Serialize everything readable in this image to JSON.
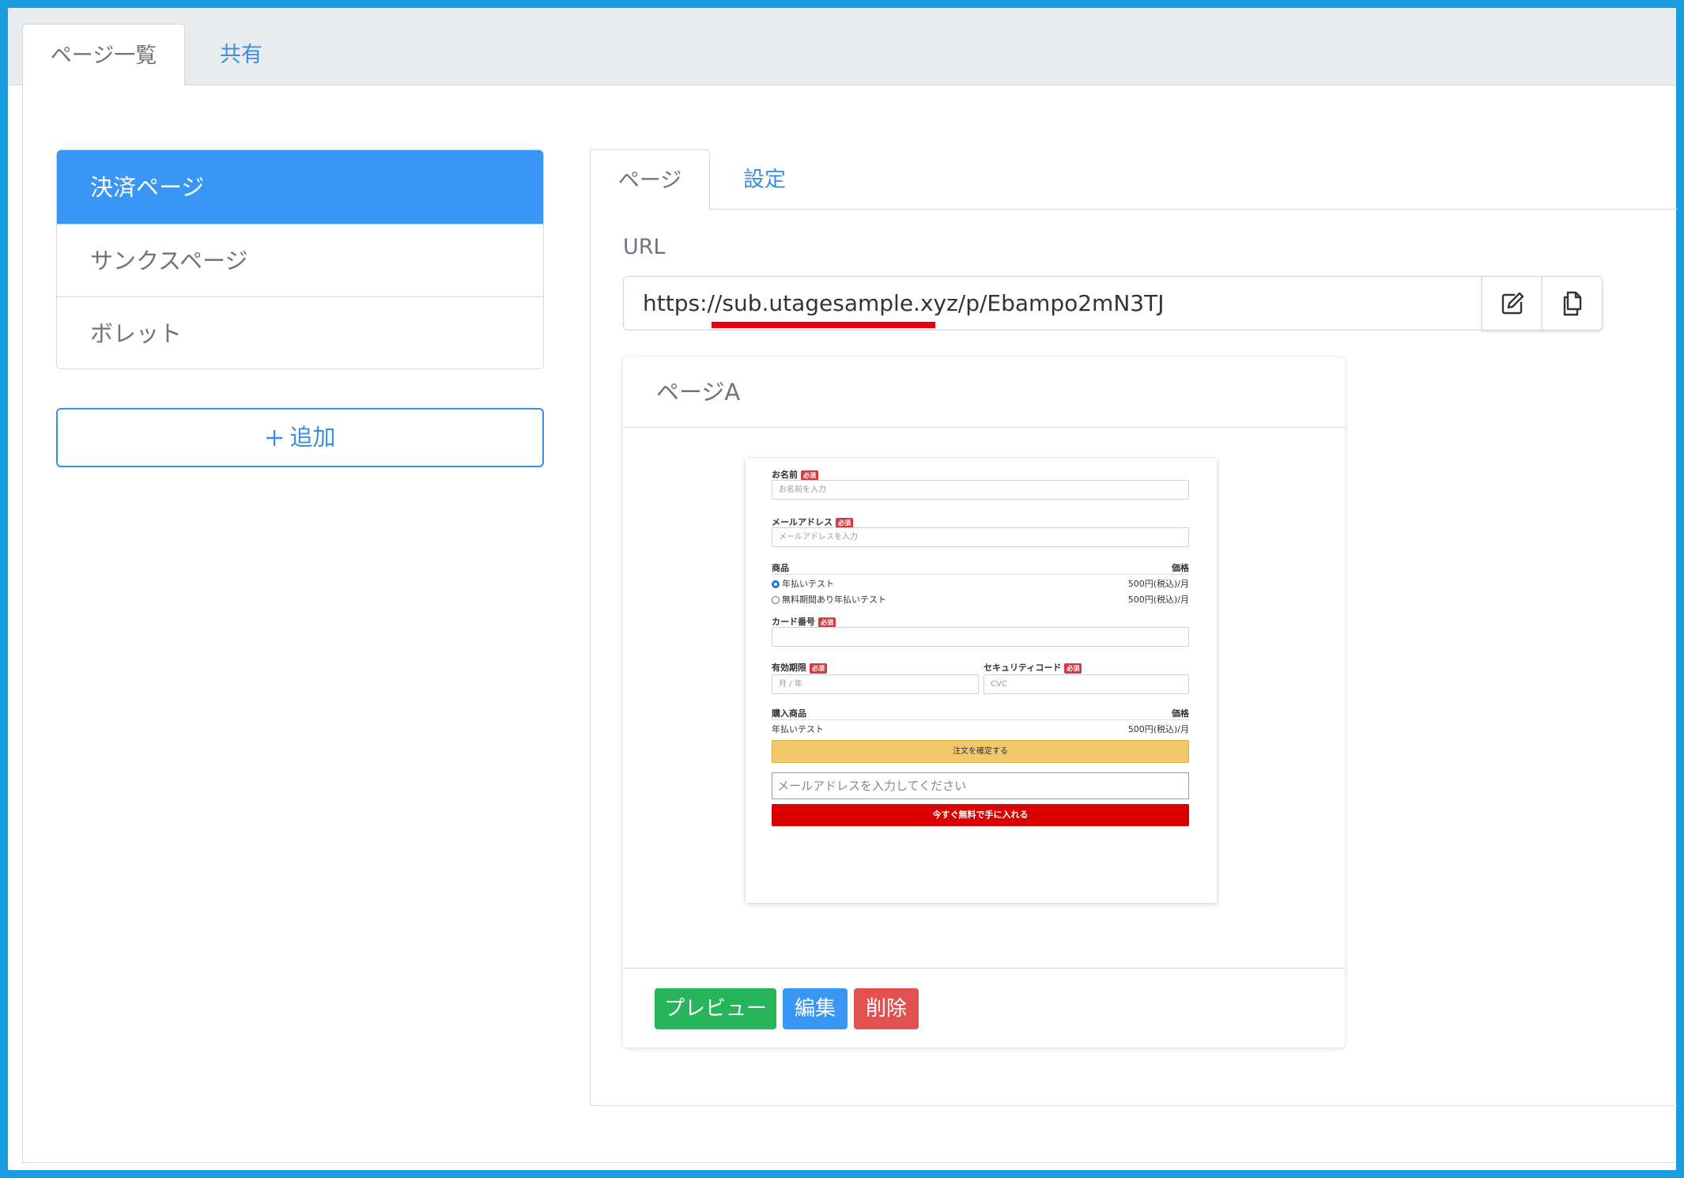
{
  "top_tabs": [
    "ページ一覧",
    "共有"
  ],
  "sidebar": {
    "items": [
      {
        "label": "決済ページ",
        "active": true
      },
      {
        "label": "サンクスページ",
        "active": false
      },
      {
        "label": "ボレット",
        "active": false
      }
    ],
    "add_label": "追加",
    "add_icon": "plus-icon"
  },
  "inner_tabs": [
    "ページ",
    "設定"
  ],
  "url": {
    "label": "URL",
    "value": "https://sub.utagesample.xyz/p/Ebampo2mN3TJ",
    "highlight_color": "#e60012",
    "edit_icon": "edit-icon",
    "copy_icon": "copy-icon"
  },
  "card": {
    "title": "ページA",
    "buttons": {
      "preview": "プレビュー",
      "edit": "編集",
      "delete": "削除"
    }
  },
  "thumbnail": {
    "required_badge": "必須",
    "name_label": "お名前",
    "name_placeholder": "お名前を入力",
    "email_label": "メールアドレス",
    "email_placeholder": "メールアドレスを入力",
    "product_header": "商品",
    "price_header": "価格",
    "products": [
      {
        "name": "年払いテスト",
        "price": "500円(税込)/月",
        "selected": true
      },
      {
        "name": "無料期間あり年払いテスト",
        "price": "500円(税込)/月",
        "selected": false
      }
    ],
    "card_label": "カード番号",
    "expiry_label": "有効期限",
    "expiry_placeholder": "月 / 年",
    "cvc_label": "セキュリティコード",
    "cvc_placeholder": "CVC",
    "purchased_header": "購入商品",
    "purchased_price_header": "価格",
    "purchased_item": "年払いテスト",
    "purchased_price": "500円(税込)/月",
    "confirm_button": "注文を確定する",
    "email_input_placeholder": "メールアドレスを入力してください",
    "cta_button": "今すぐ無料で手に入れる"
  },
  "colors": {
    "frame": "#1a9de0",
    "primary": "#3897f5",
    "success": "#27b55b",
    "danger": "#e35050"
  }
}
